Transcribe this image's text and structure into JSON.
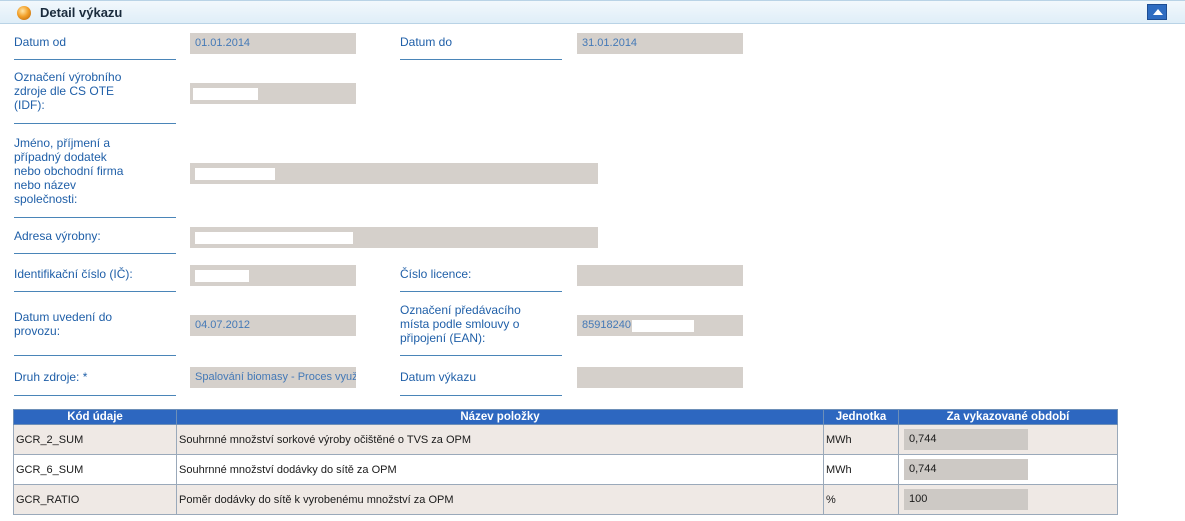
{
  "header": {
    "title": "Detail výkazu"
  },
  "form": {
    "datum_od": {
      "label": "Datum od",
      "value": "01.01.2014"
    },
    "datum_do": {
      "label": "Datum do",
      "value": "31.01.2014"
    },
    "idf": {
      "label": "Označení výrobního zdroje dle CS OTE (IDF):",
      "value": ""
    },
    "jmeno": {
      "label": "Jméno, příjmení a případný dodatek nebo obchodní firma nebo název společnosti:",
      "value": ""
    },
    "adresa": {
      "label": "Adresa výrobny:",
      "value": ""
    },
    "ic": {
      "label": "Identifikační číslo (IČ):",
      "value": ""
    },
    "licence": {
      "label": "Číslo licence:",
      "value": ""
    },
    "uvedeni": {
      "label": "Datum uvedení do provozu:",
      "value": "04.07.2012"
    },
    "ean": {
      "label": "Označení předávacího místa podle smlouvy o připojení (EAN):",
      "value": "85918240"
    },
    "druh": {
      "label": "Druh zdroje: *",
      "value": "Spalování biomasy - Proces využi"
    },
    "datum_vykazu": {
      "label": "Datum výkazu",
      "value": ""
    }
  },
  "table": {
    "headers": [
      "Kód údaje",
      "Název položky",
      "Jednotka",
      "Za vykazované období"
    ],
    "rows": [
      {
        "code": "GCR_2_SUM",
        "name": "Souhrnné množství sorkové výroby očištěné o TVS za OPM",
        "unit": "MWh",
        "value": "0,744"
      },
      {
        "code": "GCR_6_SUM",
        "name": "Souhrnné množství dodávky do sítě za OPM",
        "unit": "MWh",
        "value": "0,744"
      },
      {
        "code": "GCR_RATIO",
        "name": "Poměr dodávky do sítě k vyrobenému množství za OPM",
        "unit": "%",
        "value": "100"
      }
    ]
  }
}
